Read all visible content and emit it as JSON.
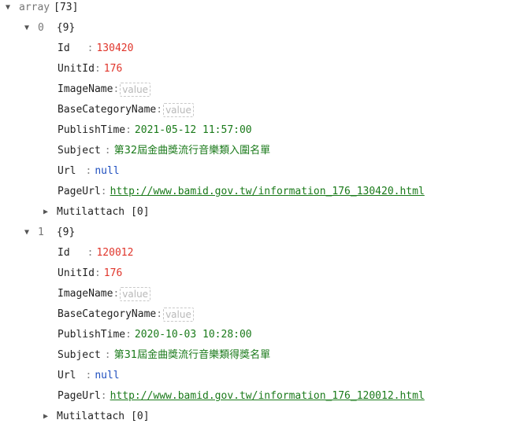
{
  "root": {
    "label": "array",
    "count": "[73]"
  },
  "items": [
    {
      "index": "0",
      "count": "{9}",
      "fields": {
        "id_key": "Id",
        "id_val": "130420",
        "unit_key": "UnitId",
        "unit_val": "176",
        "image_key": "ImageName",
        "image_placeholder": "value",
        "basecat_key": "BaseCategoryName",
        "basecat_placeholder": "value",
        "publish_key": "PublishTime",
        "publish_val": "2021-05-12 11:57:00",
        "subject_key": "Subject",
        "subject_val": "第32屆金曲獎流行音樂類入圍名單",
        "url_key": "Url",
        "url_val": "null",
        "pageurl_key": "PageUrl",
        "pageurl_val": "http://www.bamid.gov.tw/information_176_130420.html",
        "attach_key": "Mutilattach",
        "attach_count": "[0]"
      }
    },
    {
      "index": "1",
      "count": "{9}",
      "fields": {
        "id_key": "Id",
        "id_val": "120012",
        "unit_key": "UnitId",
        "unit_val": "176",
        "image_key": "ImageName",
        "image_placeholder": "value",
        "basecat_key": "BaseCategoryName",
        "basecat_placeholder": "value",
        "publish_key": "PublishTime",
        "publish_val": "2020-10-03 10:28:00",
        "subject_key": "Subject",
        "subject_val": "第31屆金曲獎流行音樂類得獎名單",
        "url_key": "Url",
        "url_val": "null",
        "pageurl_key": "PageUrl",
        "pageurl_val": "http://www.bamid.gov.tw/information_176_120012.html",
        "attach_key": "Mutilattach",
        "attach_count": "[0]"
      }
    }
  ],
  "icons": {
    "expanded": "triangle-down-icon",
    "collapsed": "triangle-right-icon"
  }
}
